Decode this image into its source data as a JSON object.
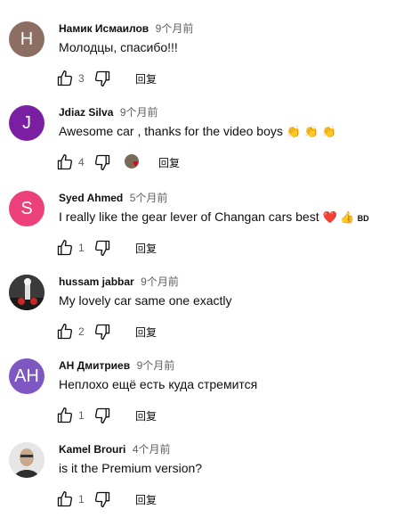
{
  "comments": [
    {
      "author": "Намик Исмаилов",
      "time": "9个月前",
      "text": "Молодцы, спасибо!!!",
      "likes": "3",
      "reply": "回复",
      "avatar_letter": "Н",
      "avatar_color": "#8d6e63"
    },
    {
      "author": "Jdiaz Silva",
      "time": "9个月前",
      "text": "Awesome car , thanks for the video boys",
      "emojis": "👏 👏 👏",
      "likes": "4",
      "reply": "回复",
      "avatar_letter": "J",
      "avatar_color": "#7b1fa2",
      "creator_heart": true
    },
    {
      "author": "Syed Ahmed",
      "time": "5个月前",
      "text": "I really like the gear lever of Changan cars best",
      "emojis": "❤️ 👍",
      "suffix": "BD",
      "likes": "1",
      "reply": "回复",
      "avatar_letter": "S",
      "avatar_color": "#ec407a"
    },
    {
      "author": "hussam jabbar",
      "time": "9个月前",
      "text": "My lovely car same one exactly",
      "likes": "2",
      "reply": "回复",
      "avatar_photo": true
    },
    {
      "author": "АН Дмитриев",
      "time": "9个月前",
      "text": "Неплохо ещё есть куда стремится",
      "likes": "1",
      "reply": "回复",
      "avatar_letter": "АН",
      "avatar_color": "#7e57c2"
    },
    {
      "author": "Kamel Brouri",
      "time": "4个月前",
      "text": "is it the Premium version?",
      "likes": "1",
      "reply": "回复",
      "avatar_photo": true
    }
  ],
  "colors": {
    "text": "#0f0f0f",
    "secondary": "#606060",
    "heart": "#e0001b"
  },
  "icons": [
    "thumb-up-icon",
    "thumb-down-icon",
    "creator-heart-icon"
  ]
}
